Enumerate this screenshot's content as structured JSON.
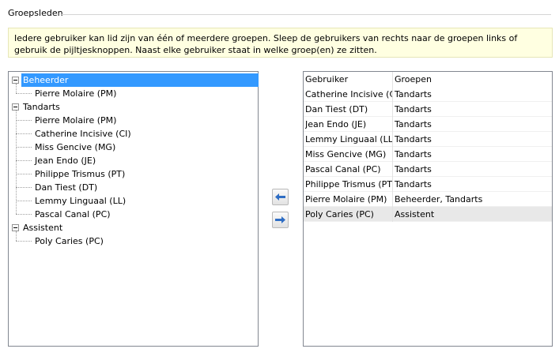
{
  "groupbox": {
    "title": "Groepsleden"
  },
  "info": {
    "text": "Iedere gebruiker kan lid zijn van één of meerdere groepen. Sleep de gebruikers van rechts naar de groepen links of gebruik de pijltjesknoppen. Naast elke gebruiker staat in welke groep(en) ze zitten."
  },
  "tree": {
    "groups": [
      {
        "label": "Beheerder",
        "selected": true,
        "members": [
          "Pierre Molaire (PM)"
        ]
      },
      {
        "label": "Tandarts",
        "selected": false,
        "members": [
          "Pierre Molaire (PM)",
          "Catherine Incisive (CI)",
          "Miss Gencive (MG)",
          "Jean Endo (JE)",
          "Philippe Trismus (PT)",
          "Dan Tiest (DT)",
          "Lemmy Linguaal (LL)",
          "Pascal Canal (PC)"
        ]
      },
      {
        "label": "Assistent",
        "selected": false,
        "members": [
          "Poly Caries (PC)"
        ]
      }
    ]
  },
  "buttons": {
    "left_icon": "arrow-left-icon",
    "right_icon": "arrow-right-icon",
    "arrow_color": "#2e6dc4"
  },
  "grid": {
    "headers": {
      "user": "Gebruiker",
      "groups": "Groepen"
    },
    "rows": [
      {
        "user": "Catherine Incisive (CI)",
        "groups": "Tandarts"
      },
      {
        "user": "Dan Tiest (DT)",
        "groups": "Tandarts"
      },
      {
        "user": "Jean Endo (JE)",
        "groups": "Tandarts"
      },
      {
        "user": "Lemmy Linguaal (LL)",
        "groups": "Tandarts"
      },
      {
        "user": "Miss Gencive (MG)",
        "groups": "Tandarts"
      },
      {
        "user": "Pascal Canal (PC)",
        "groups": "Tandarts"
      },
      {
        "user": "Philippe Trismus (PT)",
        "groups": "Tandarts"
      },
      {
        "user": "Pierre Molaire (PM)",
        "groups": "Beheerder, Tandarts"
      },
      {
        "user": "Poly Caries (PC)",
        "groups": "Assistent"
      }
    ]
  }
}
